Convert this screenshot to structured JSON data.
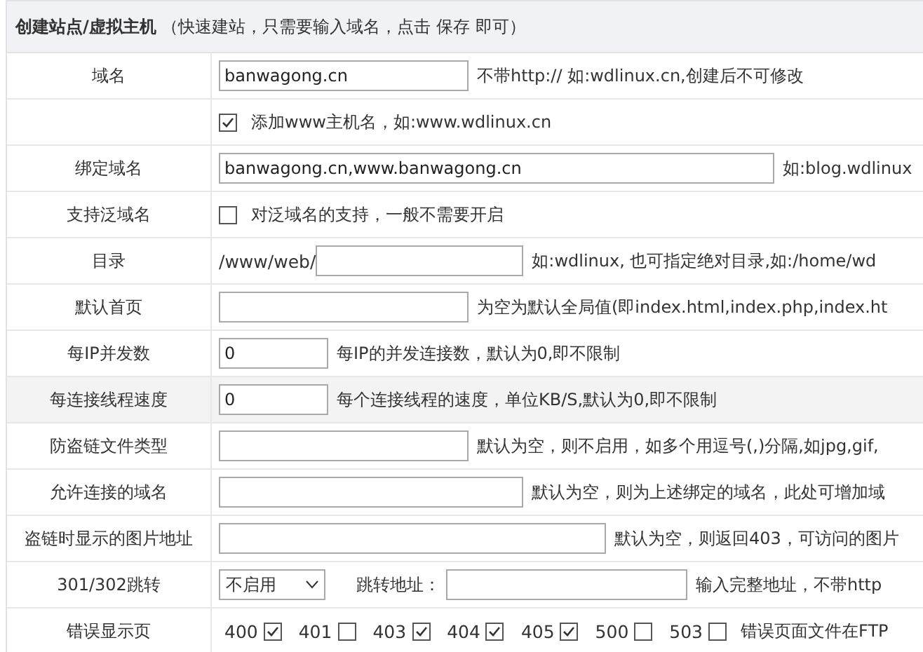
{
  "header": "**创建站点/虚拟主机** （快速建站，只需要输入域名，点击 保存 即可）",
  "rows": [
    {
      "label": "域名",
      "highlighted": false,
      "parts": [
        {
          "kind": "input",
          "value": "banwagong.cn"
        },
        {
          "kind": "text",
          "text": "不带http:// 如:wdlinux.cn,创建后不可修改"
        }
      ]
    },
    {
      "label": "",
      "highlighted": false,
      "parts": [
        {
          "kind": "checkbox",
          "checked": true
        },
        {
          "kind": "text",
          "text": "添加www主机名，如:www.wdlinux.cn"
        }
      ]
    },
    {
      "label": "绑定域名",
      "highlighted": false,
      "parts": [
        {
          "kind": "input",
          "value": "banwagong.cn,www.banwagong.cn"
        },
        {
          "kind": "text",
          "text": "如:blog.wdlinux"
        }
      ]
    },
    {
      "label": "支持泛域名",
      "highlighted": false,
      "parts": [
        {
          "kind": "checkbox",
          "checked": false
        },
        {
          "kind": "text",
          "text": "对泛域名的支持，一般不需要开启"
        }
      ]
    },
    {
      "label": "目录",
      "highlighted": false,
      "parts": [
        {
          "kind": "prefix",
          "text": "/www/web/"
        },
        {
          "kind": "input"
        },
        {
          "kind": "text",
          "text": "如:wdlinux, 也可指定绝对目录,如:/home/wd"
        }
      ]
    },
    {
      "label": "默认首页",
      "highlighted": false,
      "parts": [
        {
          "kind": "input"
        },
        {
          "kind": "text",
          "text": "为空为默认全局值(即index.html,index.php,index.ht"
        }
      ]
    },
    {
      "label": "每IP并发数",
      "highlighted": false,
      "parts": [
        {
          "kind": "input",
          "value": "0"
        },
        {
          "kind": "text",
          "text": "每IP的并发连接数，默认为0,即不限制"
        }
      ]
    },
    {
      "label": "每连接线程速度",
      "highlighted": true,
      "parts": [
        {
          "kind": "input",
          "value": "0"
        },
        {
          "kind": "text",
          "text": "每个连接线程的速度，单位KB/S,默认为0,即不限制"
        }
      ]
    },
    {
      "label": "防盗链文件类型",
      "highlighted": false,
      "parts": [
        {
          "kind": "input"
        },
        {
          "kind": "text",
          "text": "默认为空，则不启用，如多个用逗号(,)分隔,如jpg,gif,"
        }
      ]
    },
    {
      "label": "允许连接的域名",
      "highlighted": false,
      "parts": [
        {
          "kind": "input"
        },
        {
          "kind": "text",
          "text": "默认为空，则为上述绑定的域名，此处可增加域"
        }
      ]
    },
    {
      "label": "盗链时显示的图片地址",
      "highlighted": false,
      "parts": [
        {
          "kind": "input"
        },
        {
          "kind": "text",
          "text": "默认为空，则返回403，可访问的图片"
        }
      ]
    },
    {
      "label": "301/302跳转",
      "highlighted": false,
      "parts": [
        {
          "kind": "select",
          "value": "不启用"
        },
        {
          "kind": "text",
          "text": "跳转地址："
        },
        {
          "kind": "input"
        },
        {
          "kind": "text",
          "text": "输入完整地址，不带http"
        }
      ]
    },
    {
      "label": "错误显示页",
      "highlighted": false,
      "parts": [
        {
          "kind": "code",
          "text": "400"
        },
        {
          "kind": "checkbox",
          "checked": true
        },
        {
          "kind": "code",
          "text": "401"
        },
        {
          "kind": "checkbox",
          "checked": false
        },
        {
          "kind": "code",
          "text": "403"
        },
        {
          "kind": "checkbox",
          "checked": true
        },
        {
          "kind": "code",
          "text": "404"
        },
        {
          "kind": "checkbox",
          "checked": true
        },
        {
          "kind": "code",
          "text": "405"
        },
        {
          "kind": "checkbox",
          "checked": true
        },
        {
          "kind": "code",
          "text": "500"
        },
        {
          "kind": "checkbox",
          "checked": false
        },
        {
          "kind": "code",
          "text": "503"
        },
        {
          "kind": "checkbox",
          "checked": false
        },
        {
          "kind": "text",
          "text": "错误页面文件在FTP"
        }
      ]
    }
  ]
}
